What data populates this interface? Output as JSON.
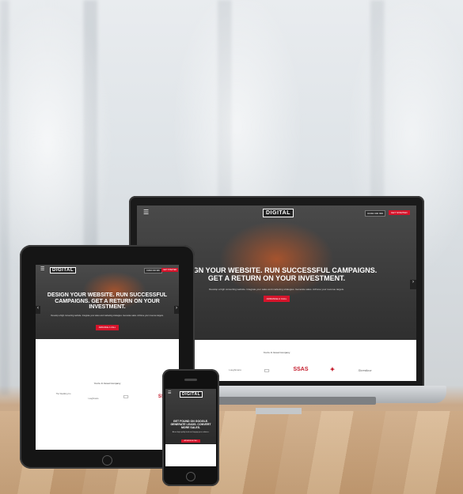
{
  "brand": "DIGITAL",
  "laptop": {
    "phone_button": "01392 000 999",
    "cta_button": "GET STARTED",
    "headline_line1": "DESIGN YOUR WEBSITE. RUN SUCCESSFUL CAMPAIGNS.",
    "headline_line2": "GET A RETURN ON YOUR INVESTMENT.",
    "subtext": "Develop a high converting website. Integrate your sales and marketing strategies. Generate sales. Achieve your revenue targets.",
    "hero_button": "ARRANGE A CALL",
    "trust_heading": "You're In Great Company",
    "logos": [
      "Loughmans",
      "CAM",
      "SSAS",
      "Badge",
      "Shredbox"
    ]
  },
  "tablet": {
    "phone_button": "01392 000 999",
    "cta_button": "GET STARTED",
    "headline": "DESIGN YOUR WEBSITE. RUN SUCCESSFUL CAMPAIGNS. GET A RETURN ON YOUR INVESTMENT.",
    "subtext": "Develop a high converting website. Integrate your sales and marketing strategies. Generate sales. Achieve your revenue targets.",
    "hero_button": "ARRANGE A CALL",
    "trust_heading": "You're In Great Company",
    "logos": [
      "The Wedding Co",
      "Loughmans",
      "CAM",
      "SSAS"
    ]
  },
  "phone": {
    "headline": "GET FOUND ON GOOGLE. GENERATE LEADS. CONVERT MORE SALES.",
    "subtext": "Attract high quality leads and engage your audience.",
    "hero_button": "ARRANGE A CALL"
  },
  "colors": {
    "accent": "#d6142b",
    "hero_dark": "#2f2f2f"
  }
}
